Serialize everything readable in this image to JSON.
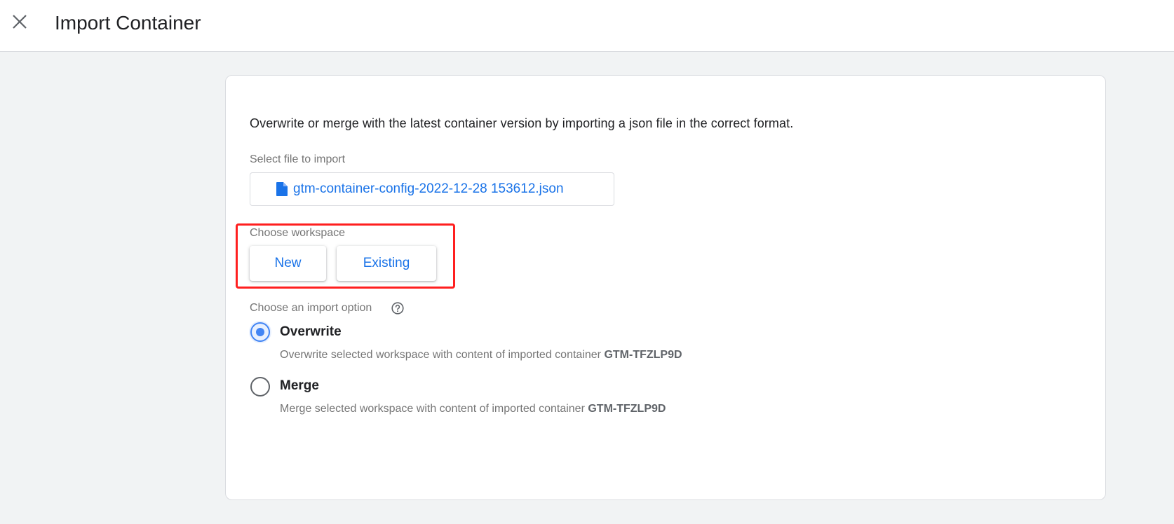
{
  "header": {
    "title": "Import Container",
    "close_icon": "close-icon"
  },
  "card": {
    "description": "Overwrite or merge with the latest container version by importing a json file in the correct format.",
    "file_section": {
      "label": "Select file to import",
      "file_icon": "file-icon",
      "file_name": "gtm-container-config-2022-12-28 153612.json"
    },
    "workspace_section": {
      "label": "Choose workspace",
      "buttons": [
        {
          "label": "New"
        },
        {
          "label": "Existing"
        }
      ]
    },
    "import_option_section": {
      "label": "Choose an import option",
      "help_icon": "help-circle-icon",
      "options": [
        {
          "title": "Overwrite",
          "description": "Overwrite selected workspace with content of imported container",
          "container_id": "GTM-TFZLP9D",
          "selected": true
        },
        {
          "title": "Merge",
          "description": "Merge selected workspace with content of imported container",
          "container_id": "GTM-TFZLP9D",
          "selected": false
        }
      ]
    }
  },
  "colors": {
    "accent": "#1a73e8",
    "radio_selected": "#4285f4",
    "highlight_annotation": "#ff1f1f",
    "background": "#f1f3f4"
  }
}
